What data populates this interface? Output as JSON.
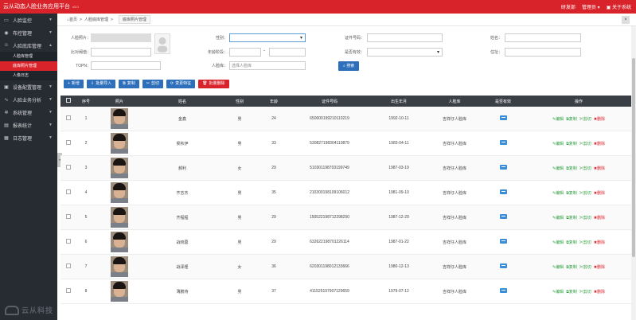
{
  "header": {
    "title": "云从动态人脸业务应用平台",
    "version": "v2.0",
    "user": "研发部",
    "role": "管理员",
    "about": "关于系统"
  },
  "sidebar": {
    "items": [
      {
        "label": "人脸监控",
        "icon": "monitor-icon"
      },
      {
        "label": "布控管理",
        "icon": "camera-icon"
      },
      {
        "label": "人脸底库管理",
        "icon": "user-icon",
        "expanded": true,
        "subs": [
          {
            "label": "人脸库管理",
            "active": false
          },
          {
            "label": "底库照片管理",
            "active": true
          },
          {
            "label": "人像日志",
            "active": false
          }
        ]
      },
      {
        "label": "设备配置管理",
        "icon": "device-icon"
      },
      {
        "label": "人脸业务分析",
        "icon": "chart-icon"
      },
      {
        "label": "系统管理",
        "icon": "gear-icon"
      },
      {
        "label": "报表统计",
        "icon": "report-icon"
      },
      {
        "label": "日志管理",
        "icon": "log-icon"
      }
    ],
    "logo_text": "云从科技"
  },
  "breadcrumb": {
    "home": "首页",
    "level1": "人脸底库管理",
    "level2": "底库照片管理"
  },
  "filters": {
    "face_photo_label": "人脸照片：",
    "compare_threshold_label": "比对阈值：",
    "topn_label": "TOPN：",
    "gender_label": "性别：",
    "age_range_label": "年龄阶段：",
    "age_sep": "-",
    "library_label": "人脸库：",
    "library_placeholder": "选择人脸库",
    "id_label": "证件号码：",
    "valid_label": "是否有效：",
    "name_label": "姓名：",
    "address_label": "住址：",
    "search_label": "搜索"
  },
  "toolbar": {
    "add": "新增",
    "batch_import": "批量导入",
    "copy": "复制",
    "cut": "剪切",
    "change_feature": "变更特征",
    "batch_delete": "批量删除"
  },
  "table": {
    "headers": [
      "序号",
      "照片",
      "姓名",
      "性别",
      "年龄",
      "证件号码",
      "出生年月",
      "人脸库",
      "是否有效",
      "操作"
    ],
    "ops": {
      "edit": "编辑",
      "copy": "复制",
      "cut": "剪切",
      "delete": "删除"
    },
    "rows": [
      {
        "idx": "1",
        "name": "金鑫",
        "gender": "男",
        "age": "24",
        "id": "650000199210110219",
        "birth": "1992-10-11",
        "library": "吉祥仔人脸库"
      },
      {
        "idx": "2",
        "name": "侯秋伊",
        "gender": "男",
        "age": "33",
        "id": "530827198304110879",
        "birth": "1983-04-11",
        "library": "吉祥仔人脸库"
      },
      {
        "idx": "3",
        "name": "郝利",
        "gender": "女",
        "age": "29",
        "id": "510301198703199749",
        "birth": "1987-03-19",
        "library": "吉祥仔人脸库"
      },
      {
        "idx": "4",
        "name": "齐志杰",
        "gender": "男",
        "age": "35",
        "id": "210300198109106012",
        "birth": "1981-09-10",
        "library": "吉祥仔人脸库"
      },
      {
        "idx": "5",
        "name": "齐程程",
        "gender": "男",
        "age": "29",
        "id": "150522198712298250",
        "birth": "1987-12-29",
        "library": "吉祥仔人脸库"
      },
      {
        "idx": "6",
        "name": "战晓蓉",
        "gender": "男",
        "age": "29",
        "id": "632622198701226114",
        "birth": "1987-01-22",
        "library": "吉祥仔人脸库"
      },
      {
        "idx": "7",
        "name": "战泽槿",
        "gender": "女",
        "age": "36",
        "id": "620301198012133666",
        "birth": "1980-12-13",
        "library": "吉祥仔人脸库"
      },
      {
        "idx": "8",
        "name": "薄鹏侍",
        "gender": "男",
        "age": "37",
        "id": "411525197907129659",
        "birth": "1979-07-12",
        "library": "吉祥仔人脸库"
      }
    ]
  },
  "colors": {
    "brand_red": "#d9232a",
    "sidebar_bg": "#272c33",
    "primary_blue": "#2d6fba",
    "op_green": "#2a9d3a"
  }
}
